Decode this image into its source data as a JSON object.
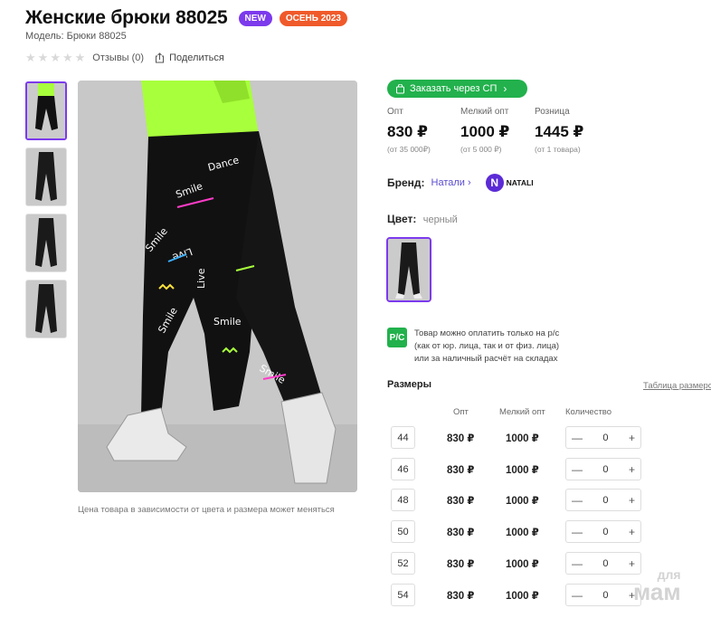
{
  "product": {
    "title": "Женские брюки 88025",
    "badge_new": "NEW",
    "badge_season": "ОСЕНЬ 2023",
    "model": "Модель: Брюки 88025",
    "reviews": "Отзывы (0)",
    "share": "Поделиться",
    "price_note": "Цена товара в зависимости от цвета и размера может меняться"
  },
  "order_button": {
    "label": "Заказать через СП"
  },
  "prices": [
    {
      "label": "Опт",
      "value": "830 ₽",
      "sub": "(от 35 000₽)"
    },
    {
      "label": "Мелкий опт",
      "value": "1000 ₽",
      "sub": "(от 5 000 ₽)"
    },
    {
      "label": "Розница",
      "value": "1445 ₽",
      "sub": "(от 1 товара)"
    }
  ],
  "brand": {
    "label": "Бренд:",
    "name": "Натали",
    "logo_text": "NATALI",
    "logo_letter": "N"
  },
  "color": {
    "label": "Цвет:",
    "value": "черный"
  },
  "payment": {
    "icon_text": "Р/С",
    "line1": "Товар можно оплатить только на р/с",
    "line2": "(как от юр. лица, так и от физ. лица)",
    "line3": "или за наличный расчёт на складах"
  },
  "sizes": {
    "title": "Размеры",
    "table_link": "Таблица размеров",
    "headers": {
      "opt": "Опт",
      "small": "Мелкий опт",
      "qty": "Количество"
    },
    "rows": [
      {
        "size": "44",
        "opt": "830 ₽",
        "small": "1000 ₽",
        "qty": "0"
      },
      {
        "size": "46",
        "opt": "830 ₽",
        "small": "1000 ₽",
        "qty": "0"
      },
      {
        "size": "48",
        "opt": "830 ₽",
        "small": "1000 ₽",
        "qty": "0"
      },
      {
        "size": "50",
        "opt": "830 ₽",
        "small": "1000 ₽",
        "qty": "0"
      },
      {
        "size": "52",
        "opt": "830 ₽",
        "small": "1000 ₽",
        "qty": "0"
      },
      {
        "size": "54",
        "opt": "830 ₽",
        "small": "1000 ₽",
        "qty": "0"
      }
    ]
  },
  "watermark": {
    "line1": "для",
    "line2": "мам"
  },
  "colors": {
    "accent": "#7c3aed",
    "green": "#22b14c",
    "season": "#f05a2a"
  }
}
